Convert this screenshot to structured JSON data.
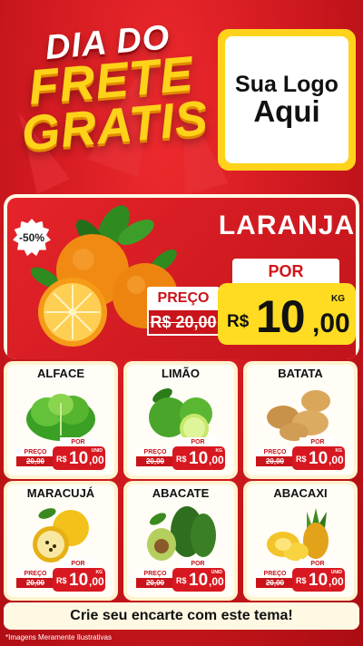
{
  "header": {
    "title_line1": "DIA DO",
    "title_line2": "FRETE",
    "title_line3": "GRATIS",
    "logo_line1": "Sua Logo",
    "logo_line2": "Aqui"
  },
  "featured": {
    "discount": "-50%",
    "name": "LARANJA",
    "preco_label": "PREÇO",
    "old_price": "R$ 20,00",
    "por_label": "POR",
    "currency": "R$",
    "price_int": "10",
    "price_dec": ",00",
    "unit": "KG"
  },
  "products": [
    {
      "name": "ALFACE",
      "preco_label": "PREÇO",
      "old_price": "20,00",
      "por_label": "POR",
      "currency": "R$",
      "price_int": "10",
      "price_dec": ",00",
      "unit": "UNID"
    },
    {
      "name": "LIMÃO",
      "preco_label": "PREÇO",
      "old_price": "20,00",
      "por_label": "POR",
      "currency": "R$",
      "price_int": "10",
      "price_dec": ",00",
      "unit": "KG"
    },
    {
      "name": "BATATA",
      "preco_label": "PREÇO",
      "old_price": "20,00",
      "por_label": "POR",
      "currency": "R$",
      "price_int": "10",
      "price_dec": ",00",
      "unit": "KG"
    },
    {
      "name": "MARACUJÁ",
      "preco_label": "PREÇO",
      "old_price": "20,00",
      "por_label": "POR",
      "currency": "R$",
      "price_int": "10",
      "price_dec": ",00",
      "unit": "KG"
    },
    {
      "name": "ABACATE",
      "preco_label": "PREÇO",
      "old_price": "20,00",
      "por_label": "POR",
      "currency": "R$",
      "price_int": "10",
      "price_dec": ",00",
      "unit": "UNID"
    },
    {
      "name": "ABACAXI",
      "preco_label": "PREÇO",
      "old_price": "20,00",
      "por_label": "POR",
      "currency": "R$",
      "price_int": "10",
      "price_dec": ",00",
      "unit": "UNID"
    }
  ],
  "footer": {
    "cta": "Crie seu encarte com este tema!",
    "disclaimer": "*Imagens Meramente Ilustrativas"
  },
  "colors": {
    "background": "#c4121a",
    "accent_yellow": "#ffd21a",
    "price_red": "#d81820"
  }
}
